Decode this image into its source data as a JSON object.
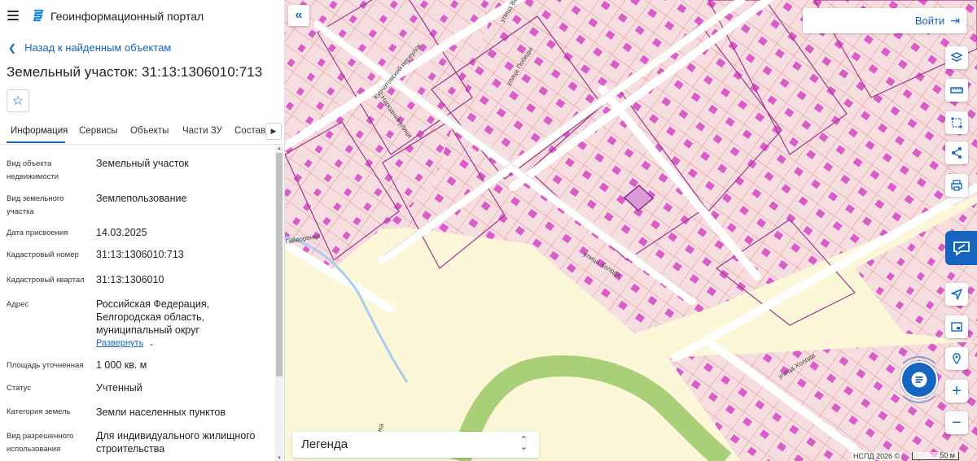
{
  "header": {
    "app_title": "Геоинформационный портал",
    "menu_icon": "hamburger-icon",
    "logo_icon": "portal-logo-icon"
  },
  "nav": {
    "back_label": "Назад к найденным объектам"
  },
  "object": {
    "title": "Земельный участок: 31:13:1306010:713"
  },
  "tabs": [
    {
      "label": "Информация",
      "active": true
    },
    {
      "label": "Сервисы"
    },
    {
      "label": "Объекты"
    },
    {
      "label": "Части ЗУ"
    },
    {
      "label": "Состав"
    }
  ],
  "properties": [
    {
      "label": "Вид объекта недвижимости",
      "value": "Земельный участок"
    },
    {
      "label": "Вид земельного участка",
      "value": "Землепользование"
    },
    {
      "label": "Дата присвоения",
      "value": "14.03.2025"
    },
    {
      "label": "Кадастровый номер",
      "value": "31:13:1306010:713"
    },
    {
      "label": "Кадастровый квартал",
      "value": "31:13:1306010"
    },
    {
      "label": "Адрес",
      "value": "Российская Федерация, Белгородская область, муниципальный округ"
    },
    {
      "label": "Площадь уточненная",
      "value": "1 000 кв. м"
    },
    {
      "label": "Статус",
      "value": "Учтенный"
    },
    {
      "label": "Категория земель",
      "value": "Земли населенных пунктов"
    },
    {
      "label": "Вид разрешенного использования",
      "value": "Для индивидуального жилищного строительства"
    }
  ],
  "address_expand_label": "Развернуть",
  "map": {
    "login_label": "Войти",
    "legend_label": "Легенда",
    "attribution": "НСПД 2026 ©",
    "scale_label": "50 м",
    "streets": [
      "Курчатовский переулок",
      "Народная улица",
      "улица Победы",
      "улица Веченко",
      "улица Холода",
      "улица Холода",
      "Гайворонка",
      "Гайворонка"
    ],
    "tools": [
      "layers-icon",
      "ruler-icon",
      "select-area-icon",
      "share-icon",
      "print-icon",
      "feedback-icon",
      "locate-icon",
      "minimap-icon",
      "pin-icon",
      "zoom-in-icon",
      "zoom-out-icon"
    ]
  },
  "colors": {
    "accent": "#1565c0",
    "parcel_fill": "#f6dde0",
    "parcel_line": "#e58a86",
    "building": "#d95cc9",
    "quarter_line": "#a0358e",
    "road": "#ffffff",
    "farmland": "#fbf7d8",
    "green": "#a9cf77",
    "water": "#a9cdf0"
  }
}
